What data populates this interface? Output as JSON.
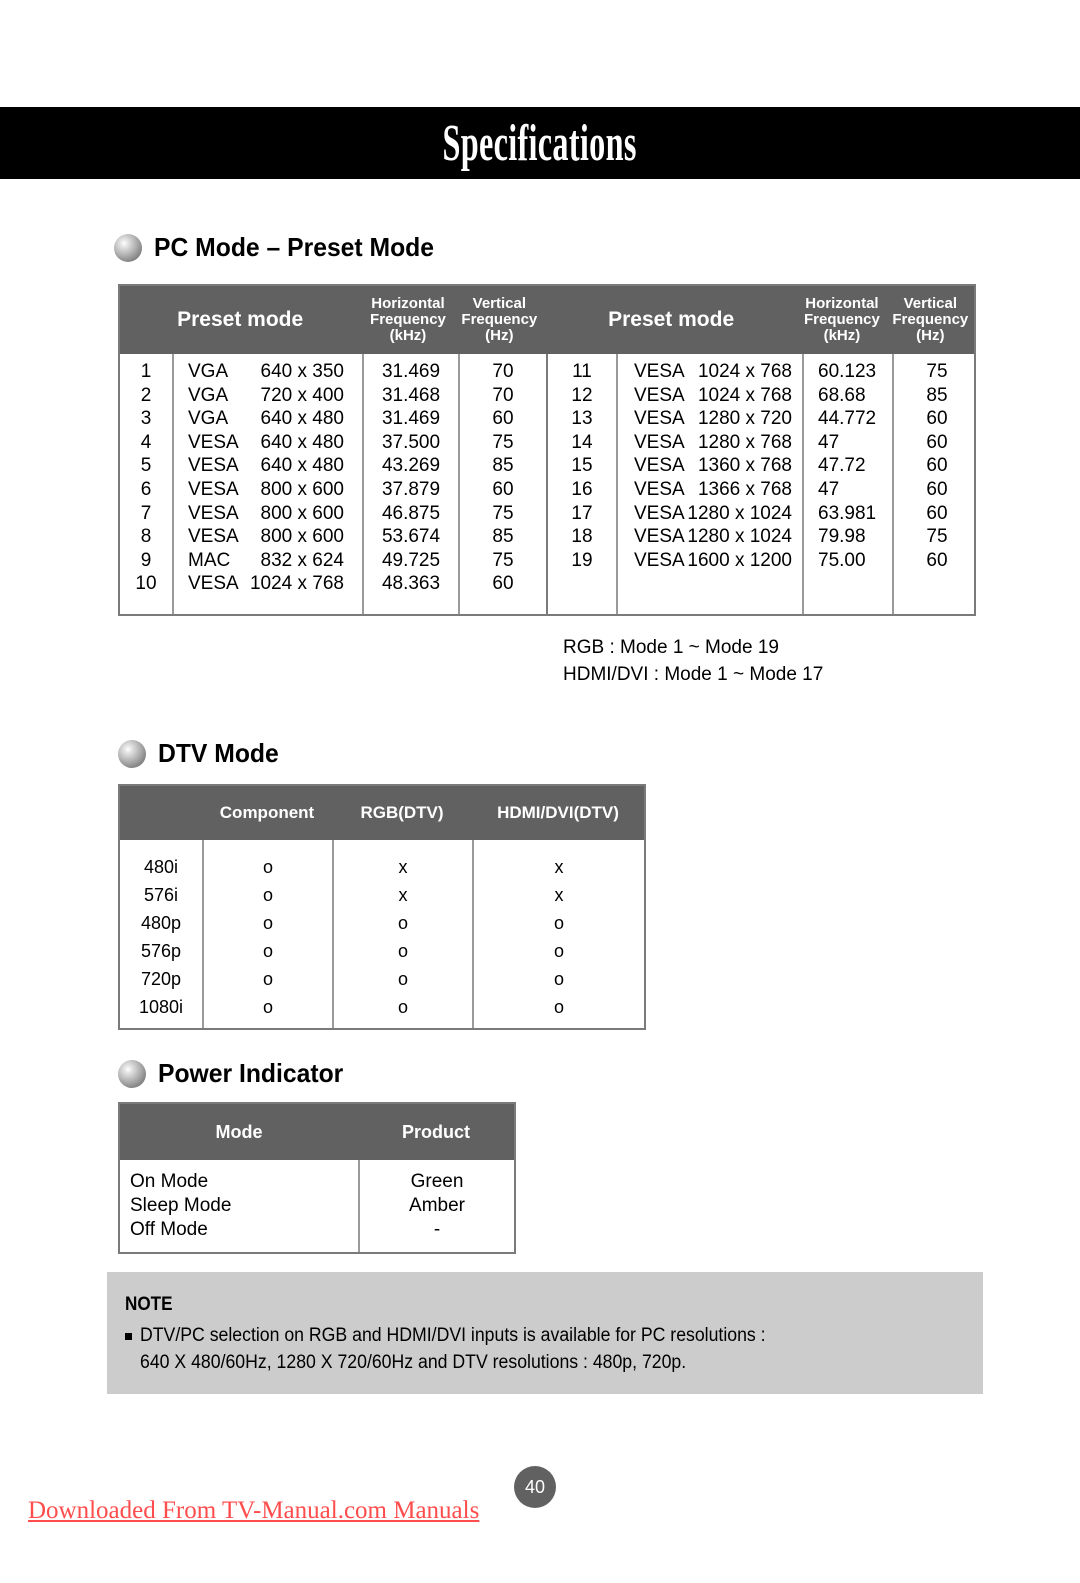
{
  "banner": {
    "title": "Specifications"
  },
  "sections": {
    "pc_mode": {
      "heading": "PC Mode – Preset Mode"
    },
    "dtv_mode": {
      "heading": "DTV Mode"
    },
    "power_indicator": {
      "heading": "Power Indicator"
    }
  },
  "pc_table": {
    "headers": {
      "preset_mode": "Preset mode",
      "horizontal_frequency": "Horizontal\nFrequency\n(kHz)",
      "horizontal_frequency_line1": "Horizontal",
      "horizontal_frequency_line2": "Frequency",
      "horizontal_frequency_line3": "(kHz)",
      "vertical_frequency_line1": "Vertical",
      "vertical_frequency_line2": "Frequency",
      "vertical_frequency_line3": "(Hz)"
    },
    "left_rows": [
      {
        "index": "1",
        "standard": "VGA",
        "resolution": "640 x 350",
        "h_freq": "31.469",
        "v_freq": "70"
      },
      {
        "index": "2",
        "standard": "VGA",
        "resolution": "720 x 400",
        "h_freq": "31.468",
        "v_freq": "70"
      },
      {
        "index": "3",
        "standard": "VGA",
        "resolution": "640 x 480",
        "h_freq": "31.469",
        "v_freq": "60"
      },
      {
        "index": "4",
        "standard": "VESA",
        "resolution": "640 x 480",
        "h_freq": "37.500",
        "v_freq": "75"
      },
      {
        "index": "5",
        "standard": "VESA",
        "resolution": "640 x 480",
        "h_freq": "43.269",
        "v_freq": "85"
      },
      {
        "index": "6",
        "standard": "VESA",
        "resolution": "800 x 600",
        "h_freq": "37.879",
        "v_freq": "60"
      },
      {
        "index": "7",
        "standard": "VESA",
        "resolution": "800 x 600",
        "h_freq": "46.875",
        "v_freq": "75"
      },
      {
        "index": "8",
        "standard": "VESA",
        "resolution": "800 x 600",
        "h_freq": "53.674",
        "v_freq": "85"
      },
      {
        "index": "9",
        "standard": "MAC",
        "resolution": "832 x 624",
        "h_freq": "49.725",
        "v_freq": "75"
      },
      {
        "index": "10",
        "standard": "VESA",
        "resolution": "1024 x 768",
        "h_freq": "48.363",
        "v_freq": "60"
      }
    ],
    "right_rows": [
      {
        "index": "11",
        "standard": "VESA",
        "resolution": "1024 x 768",
        "h_freq": "60.123",
        "v_freq": "75"
      },
      {
        "index": "12",
        "standard": "VESA",
        "resolution": "1024 x 768",
        "h_freq": "68.68",
        "v_freq": "85"
      },
      {
        "index": "13",
        "standard": "VESA",
        "resolution": "1280 x 720",
        "h_freq": "44.772",
        "v_freq": "60"
      },
      {
        "index": "14",
        "standard": "VESA",
        "resolution": "1280 x 768",
        "h_freq": "47",
        "v_freq": "60"
      },
      {
        "index": "15",
        "standard": "VESA",
        "resolution": "1360 x 768",
        "h_freq": "47.72",
        "v_freq": "60"
      },
      {
        "index": "16",
        "standard": "VESA",
        "resolution": "1366 x 768",
        "h_freq": "47",
        "v_freq": "60"
      },
      {
        "index": "17",
        "standard": "VESA",
        "resolution": "1280 x 1024",
        "h_freq": "63.981",
        "v_freq": "60"
      },
      {
        "index": "18",
        "standard": "VESA",
        "resolution": "1280 x 1024",
        "h_freq": "79.98",
        "v_freq": "75"
      },
      {
        "index": "19",
        "standard": "VESA",
        "resolution": "1600 x 1200",
        "h_freq": "75.00",
        "v_freq": "60"
      }
    ]
  },
  "mode_ranges": {
    "rgb": "RGB : Mode 1 ~ Mode 19",
    "hdmi_dvi": "HDMI/DVI : Mode 1 ~ Mode 17"
  },
  "dtv_table": {
    "headers": {
      "blank": "",
      "component": "Component",
      "rgb_dtv": "RGB(DTV)",
      "hdmi_dvi_dtv": "HDMI/DVI(DTV)"
    },
    "rows": [
      {
        "format": "480i",
        "component": "o",
        "rgb_dtv": "x",
        "hdmi_dvi_dtv": "x"
      },
      {
        "format": "576i",
        "component": "o",
        "rgb_dtv": "x",
        "hdmi_dvi_dtv": "x"
      },
      {
        "format": "480p",
        "component": "o",
        "rgb_dtv": "o",
        "hdmi_dvi_dtv": "o"
      },
      {
        "format": "576p",
        "component": "o",
        "rgb_dtv": "o",
        "hdmi_dvi_dtv": "o"
      },
      {
        "format": "720p",
        "component": "o",
        "rgb_dtv": "o",
        "hdmi_dvi_dtv": "o"
      },
      {
        "format": "1080i",
        "component": "o",
        "rgb_dtv": "o",
        "hdmi_dvi_dtv": "o"
      }
    ]
  },
  "power_table": {
    "headers": {
      "mode": "Mode",
      "product": "Product"
    },
    "rows": [
      {
        "mode": "On Mode",
        "product": "Green"
      },
      {
        "mode": "Sleep Mode",
        "product": "Amber"
      },
      {
        "mode": "Off Mode",
        "product": "-"
      }
    ]
  },
  "note": {
    "title": "NOTE",
    "line1": "DTV/PC selection on RGB and HDMI/DVI inputs is available for PC resolutions :",
    "line2": "640 X 480/60Hz, 1280 X 720/60Hz and DTV resolutions : 480p, 720p."
  },
  "footer": {
    "page_number": "40",
    "watermark": "Downloaded From TV-Manual.com Manuals"
  },
  "colors": {
    "banner_bg": "#000000",
    "table_header_bg": "#616161",
    "note_bg": "#cccccc",
    "watermark": "#ff4d4d",
    "table_border": "#7a7a7a"
  }
}
